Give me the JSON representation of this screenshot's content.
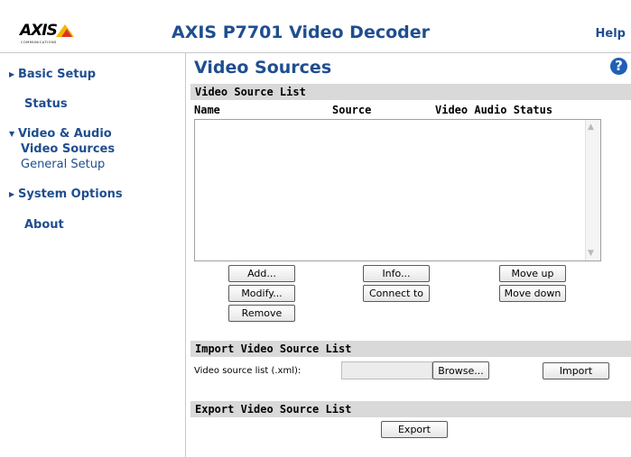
{
  "header": {
    "logo_text": "AXIS",
    "logo_subtext": "COMMUNICATIONS",
    "product_title": "AXIS P7701 Video Decoder",
    "help_label": "Help"
  },
  "sidebar": {
    "items": [
      {
        "label": "Basic Setup"
      },
      {
        "label": "Status"
      },
      {
        "label": "Video & Audio"
      },
      {
        "label": "System Options"
      },
      {
        "label": "About"
      }
    ],
    "subitems": [
      {
        "label": "Video Sources",
        "active": true
      },
      {
        "label": "General Setup"
      }
    ]
  },
  "main": {
    "page_title": "Video Sources",
    "help_icon": "?",
    "source_list_section": {
      "title": "Video Source List",
      "columns": [
        "Name",
        "Source",
        "Video Audio Status"
      ],
      "rows": []
    },
    "buttons": {
      "add": "Add...",
      "modify": "Modify...",
      "remove": "Remove",
      "info": "Info...",
      "connect": "Connect to",
      "move_up": "Move up",
      "move_down": "Move down"
    },
    "import_section": {
      "title": "Import Video Source List",
      "label": "Video source list (.xml):",
      "file_value": "",
      "browse_label": "Browse...",
      "import_label": "Import"
    },
    "export_section": {
      "title": "Export Video Source List",
      "export_label": "Export"
    }
  },
  "colors": {
    "brand_blue": "#1f4e8f",
    "section_bar": "#d9d9d9",
    "help_icon_bg": "#1f5fb5"
  },
  "icons": [
    "arrow-right-icon",
    "arrow-down-icon",
    "help-question-icon",
    "scroll-up-arrow-icon",
    "scroll-down-arrow-icon"
  ]
}
